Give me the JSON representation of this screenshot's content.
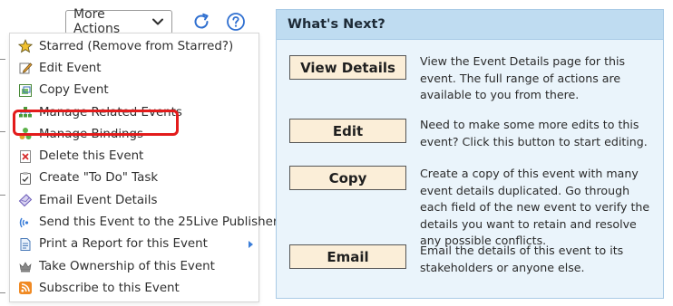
{
  "toolbar": {
    "more_actions_label": "More Actions",
    "icons": [
      "refresh-icon",
      "help-icon"
    ]
  },
  "menu": {
    "items": [
      {
        "label": "Starred (Remove from Starred?)",
        "icon": "star-icon"
      },
      {
        "label": "Edit Event",
        "icon": "edit-icon"
      },
      {
        "label": "Copy Event",
        "icon": "copy-icon",
        "highlighted": true
      },
      {
        "label": "Manage Related Events",
        "icon": "related-events-icon"
      },
      {
        "label": "Manage Bindings",
        "icon": "bindings-icon"
      },
      {
        "label": "Delete this Event",
        "icon": "delete-icon"
      },
      {
        "label": "Create \"To Do\" Task",
        "icon": "todo-icon"
      },
      {
        "label": "Email Event Details",
        "icon": "email-icon"
      },
      {
        "label": "Send this Event to the 25Live Publisher",
        "icon": "publisher-icon"
      },
      {
        "label": "Print a Report for this Event",
        "icon": "report-icon",
        "has_submenu": true
      },
      {
        "label": "Take Ownership of this Event",
        "icon": "ownership-icon"
      },
      {
        "label": "Subscribe to this Event",
        "icon": "rss-icon"
      }
    ],
    "highlight_color": "#e31b1b"
  },
  "panel": {
    "title": "What's Next?",
    "actions": [
      {
        "button": "View Details",
        "description": "View the Event Details page for this event. The full range of actions are available to you from there."
      },
      {
        "button": "Edit",
        "description": "Need to make some more edits to this event? Click this button to start editing."
      },
      {
        "button": "Copy",
        "description": "Create a copy of this event with many event details duplicated. Go through each field of the new event to verify the details you want to retain and resolve any possible conflicts."
      },
      {
        "button": "Email",
        "description": "Email the details of this event to its stakeholders or anyone else."
      }
    ]
  },
  "colors": {
    "panel_bg": "#eaf4fb",
    "panel_header_bg": "#bfdcf1",
    "button_bg": "#fbeed8",
    "accent_blue": "#3b7dd8"
  }
}
